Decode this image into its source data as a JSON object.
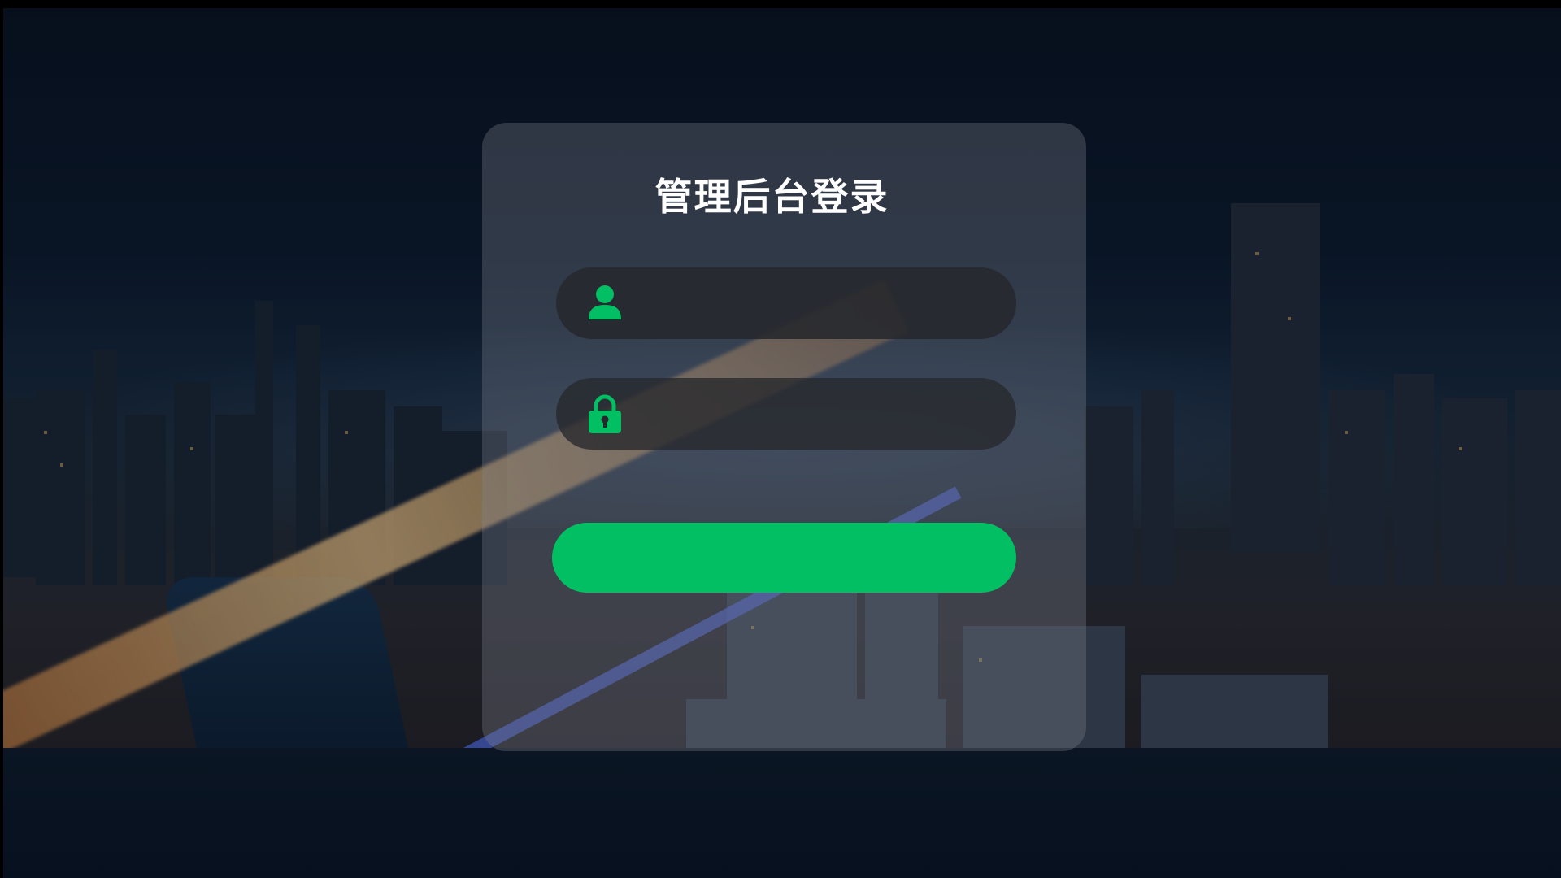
{
  "page": {
    "title": "管理后台登录",
    "background": "night-city-skyline"
  },
  "login": {
    "username": {
      "icon": "user-icon",
      "value": "",
      "placeholder": ""
    },
    "password": {
      "icon": "lock-icon",
      "value": "",
      "placeholder": ""
    },
    "submit_label": ""
  },
  "colors": {
    "accent": "#03bf63",
    "panel": "#8a8f99",
    "field": "#26282c",
    "title": "#ffffff"
  }
}
